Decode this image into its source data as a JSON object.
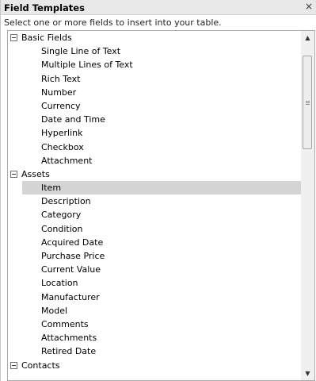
{
  "header": {
    "title": "Field Templates",
    "close_label": "×"
  },
  "hint": "Select one or more fields to insert into your table.",
  "list": [
    {
      "kind": "group",
      "label": "Basic Fields",
      "name": "group-basic-fields"
    },
    {
      "kind": "item",
      "label": "Single Line of Text",
      "name": "field-single-line-of-text"
    },
    {
      "kind": "item",
      "label": "Multiple Lines of Text",
      "name": "field-multiple-lines-of-text"
    },
    {
      "kind": "item",
      "label": "Rich Text",
      "name": "field-rich-text"
    },
    {
      "kind": "item",
      "label": "Number",
      "name": "field-number"
    },
    {
      "kind": "item",
      "label": "Currency",
      "name": "field-currency"
    },
    {
      "kind": "item",
      "label": "Date and Time",
      "name": "field-date-and-time"
    },
    {
      "kind": "item",
      "label": "Hyperlink",
      "name": "field-hyperlink"
    },
    {
      "kind": "item",
      "label": "Checkbox",
      "name": "field-checkbox"
    },
    {
      "kind": "item",
      "label": "Attachment",
      "name": "field-attachment"
    },
    {
      "kind": "group",
      "label": "Assets",
      "name": "group-assets"
    },
    {
      "kind": "item",
      "label": "Item",
      "name": "field-item",
      "selected": true
    },
    {
      "kind": "item",
      "label": "Description",
      "name": "field-description"
    },
    {
      "kind": "item",
      "label": "Category",
      "name": "field-category"
    },
    {
      "kind": "item",
      "label": "Condition",
      "name": "field-condition"
    },
    {
      "kind": "item",
      "label": "Acquired Date",
      "name": "field-acquired-date"
    },
    {
      "kind": "item",
      "label": "Purchase Price",
      "name": "field-purchase-price"
    },
    {
      "kind": "item",
      "label": "Current Value",
      "name": "field-current-value"
    },
    {
      "kind": "item",
      "label": "Location",
      "name": "field-location"
    },
    {
      "kind": "item",
      "label": "Manufacturer",
      "name": "field-manufacturer"
    },
    {
      "kind": "item",
      "label": "Model",
      "name": "field-model"
    },
    {
      "kind": "item",
      "label": "Comments",
      "name": "field-comments"
    },
    {
      "kind": "item",
      "label": "Attachments",
      "name": "field-attachments"
    },
    {
      "kind": "item",
      "label": "Retired Date",
      "name": "field-retired-date"
    },
    {
      "kind": "group",
      "label": "Contacts",
      "name": "group-contacts"
    }
  ]
}
